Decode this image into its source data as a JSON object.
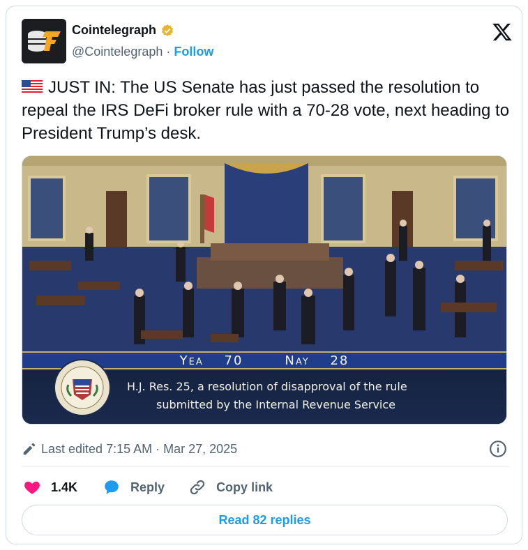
{
  "header": {
    "display_name": "Cointelegraph",
    "handle": "@Cointelegraph",
    "separator": "·",
    "follow_label": "Follow",
    "verified_color": "#e9b52f",
    "avatar_icon": "cointelegraph-logo-icon",
    "platform_icon": "x-logo-icon"
  },
  "tweet": {
    "flag_icon": "us-flag-icon",
    "text": "JUST IN: The US Senate has just passed the resolution to repeal the IRS DeFi broker rule with a 70-28 vote, next heading to President Trump’s desk."
  },
  "media": {
    "yea_label": "Yea",
    "yea_count": "70",
    "nay_label": "Nay",
    "nay_count": "28",
    "caption_line1": "H.J. Res. 25, a resolution of disapproval of the rule",
    "caption_line2": "submitted by the Internal Revenue Service",
    "seal_icon": "us-senate-seal-icon"
  },
  "meta": {
    "edited_text": "Last edited 7:15 AM · Mar 27, 2025"
  },
  "actions": {
    "like_count": "1.4K",
    "reply_label": "Reply",
    "copy_label": "Copy link"
  },
  "footer": {
    "read_replies_label": "Read 82 replies"
  },
  "colors": {
    "accent": "#1d9bf0",
    "like": "#f91880",
    "text_secondary": "#536471",
    "border": "#cfd9de"
  }
}
